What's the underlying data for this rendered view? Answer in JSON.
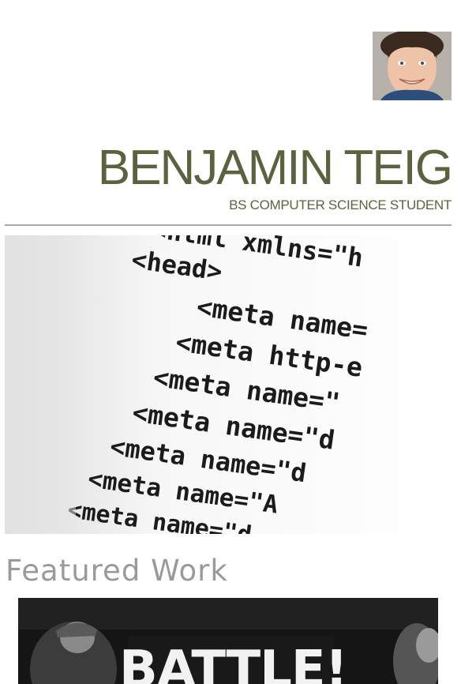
{
  "profile": {
    "name": "BENJAMIN TEIG",
    "subtitle": "BS COMPUTER SCIENCE STUDENT"
  },
  "hero": {
    "code_lines": [
      "<html xmlns=\"h",
      "<head>",
      "<meta name=",
      "<meta http-e",
      "<meta name=\"",
      "<meta name=\"d",
      "<meta name=\"d",
      "<meta name=\"A",
      "<meta name=\"d"
    ]
  },
  "featured": {
    "heading": "Featured Work",
    "items": [
      {
        "title": "BATTLE!"
      }
    ]
  },
  "colors": {
    "name_olive": "#5c6240",
    "divider_gray": "#a9a9a9",
    "heading_gray": "#9a9a9a"
  }
}
